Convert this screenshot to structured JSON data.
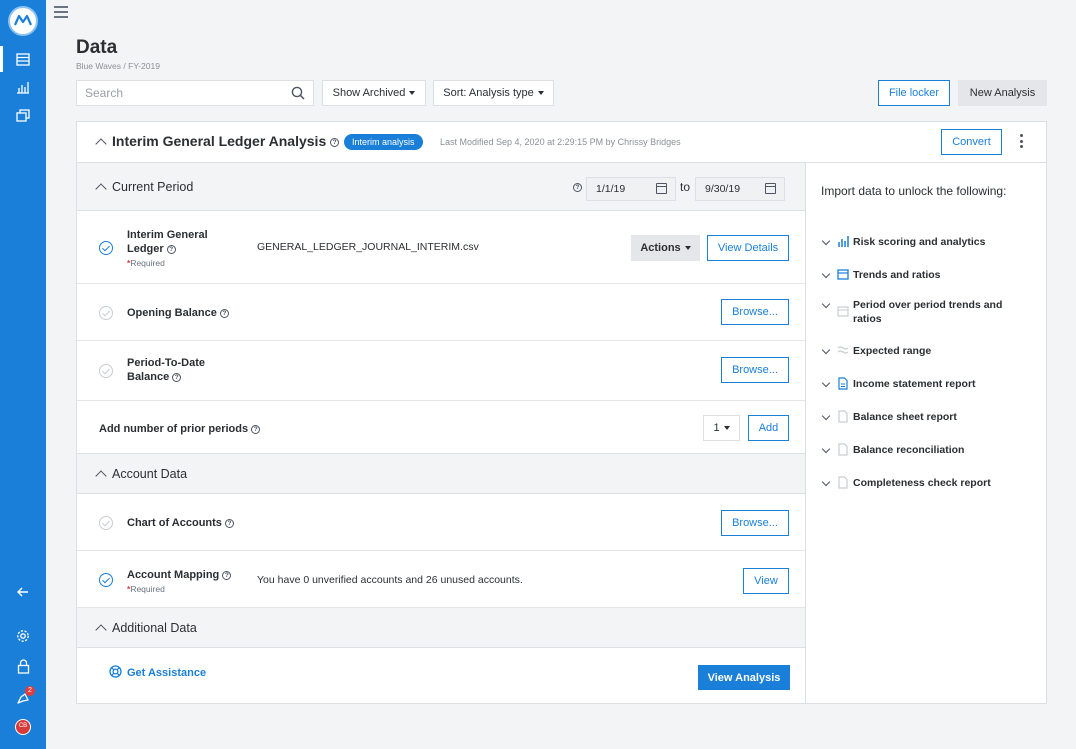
{
  "nav": {
    "logo_icon": "mindbridge-logo-icon",
    "items": [
      "data-icon",
      "analytics-icon",
      "tasks-icon"
    ],
    "bottom": [
      "collapse-arrow-icon",
      "settings-icon",
      "lock-icon",
      "notifications-icon"
    ],
    "notification_count": "2",
    "avatar_initials": "CB"
  },
  "page": {
    "title": "Data",
    "breadcrumb": "Blue Waves / FY-2019"
  },
  "toolbar": {
    "search_placeholder": "Search",
    "show_archived": "Show Archived",
    "sort": "Sort: Analysis type",
    "file_locker": "File locker",
    "new_analysis": "New Analysis"
  },
  "analysis": {
    "title": "Interim General Ledger Analysis",
    "tag": "Interim analysis",
    "last_modified": "Last Modified Sep 4, 2020 at 2:29:15 PM by Chrissy Bridges",
    "convert": "Convert"
  },
  "current_period": {
    "title": "Current Period",
    "start_date": "1/1/19",
    "to_label": "to",
    "end_date": "9/30/19"
  },
  "rows": {
    "gl": {
      "label_line1": "Interim General",
      "label_line2": "Ledger",
      "required": "Required",
      "file": "GENERAL_LEDGER_JOURNAL_INTERIM.csv",
      "actions": "Actions",
      "view_details": "View Details"
    },
    "opening": {
      "label": "Opening Balance",
      "browse": "Browse..."
    },
    "ptd": {
      "label_line1": "Period-To-Date",
      "label_line2": "Balance",
      "browse": "Browse..."
    },
    "prior": {
      "label": "Add number of prior periods",
      "count": "1",
      "add": "Add"
    }
  },
  "account_data": {
    "title": "Account Data",
    "coa": {
      "label": "Chart of Accounts",
      "browse": "Browse..."
    },
    "mapping": {
      "label": "Account Mapping",
      "required": "Required",
      "message": "You have 0 unverified accounts and 26 unused accounts.",
      "view": "View"
    }
  },
  "additional_data": {
    "title": "Additional Data",
    "assist": "Get Assistance",
    "view_analysis": "View Analysis"
  },
  "unlock": {
    "title": "Import data to unlock the following:",
    "features": [
      {
        "label": "Risk scoring and analytics",
        "icon": "bar-chart-icon",
        "active": true
      },
      {
        "label": "Trends and ratios",
        "icon": "calendar-icon",
        "active": true
      },
      {
        "label": "Period over period trends and ratios",
        "icon": "calendar-icon",
        "active": false
      },
      {
        "label": "Expected range",
        "icon": "range-icon",
        "active": false
      },
      {
        "label": "Income statement report",
        "icon": "document-icon",
        "active": true
      },
      {
        "label": "Balance sheet report",
        "icon": "document-icon",
        "active": false
      },
      {
        "label": "Balance reconciliation",
        "icon": "document-icon",
        "active": false
      },
      {
        "label": "Completeness check report",
        "icon": "document-icon",
        "active": false
      }
    ]
  },
  "colors": {
    "brand": "#1a7fd8",
    "required": "#d63a3a"
  }
}
